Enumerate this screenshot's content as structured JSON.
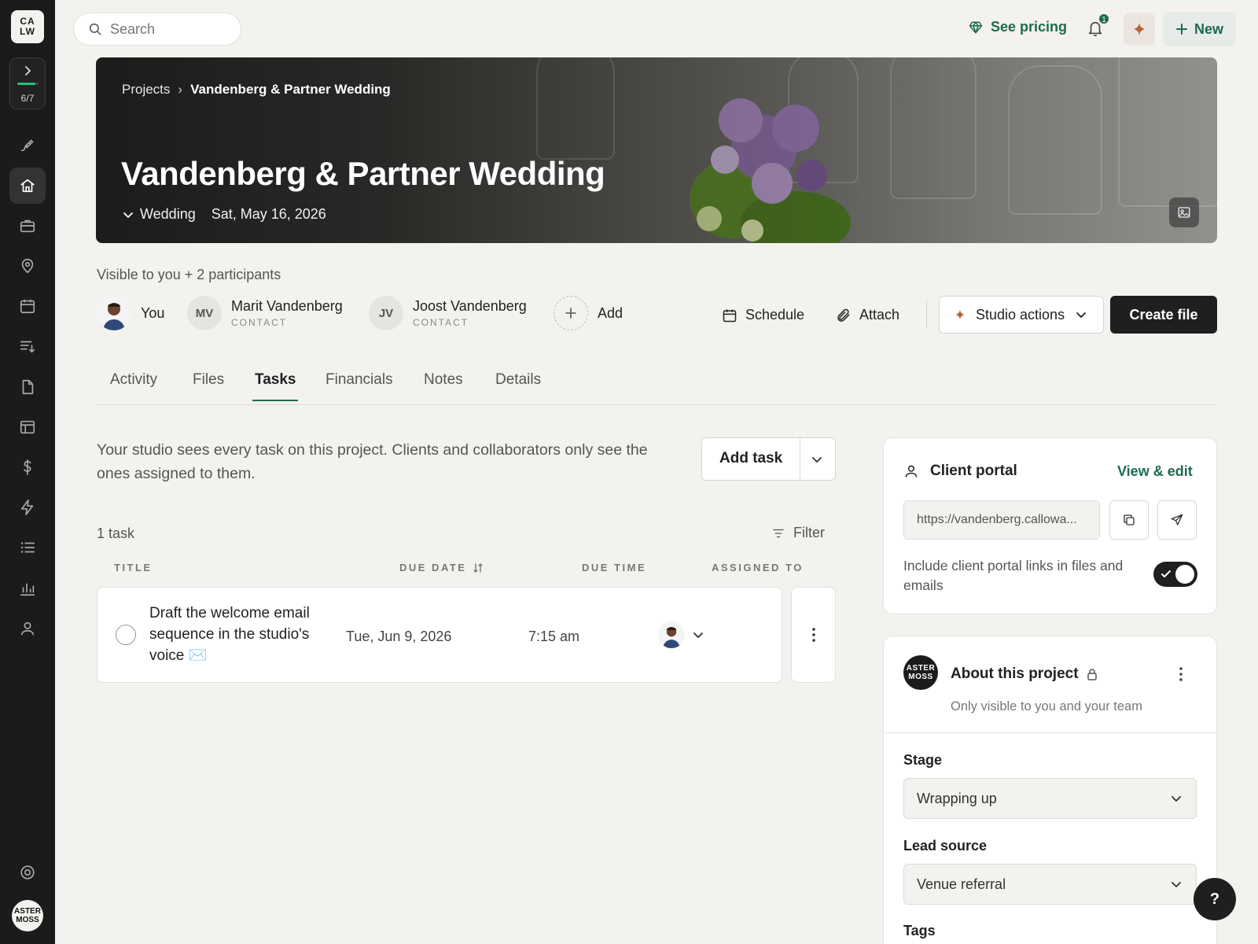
{
  "sidebar": {
    "logo": "CA\nLW",
    "progress": {
      "label": "6/7",
      "fraction": 0.857
    },
    "user_initials": "ASTER\nMOSS"
  },
  "topbar": {
    "search_placeholder": "Search",
    "see_pricing": "See pricing",
    "notification_count": "1",
    "new_label": "New"
  },
  "hero": {
    "breadcrumb_root": "Projects",
    "breadcrumb_sep": "›",
    "breadcrumb_current": "Vandenberg & Partner Wedding",
    "title": "Vandenberg & Partner Wedding",
    "type": "Wedding",
    "date": "Sat, May 16, 2026"
  },
  "participants": {
    "visibility": "Visible to you + 2 participants",
    "you": "You",
    "people": [
      {
        "initials": "MV",
        "name": "Marit Vandenberg",
        "role": "CONTACT"
      },
      {
        "initials": "JV",
        "name": "Joost Vandenberg",
        "role": "CONTACT"
      }
    ],
    "add": "Add"
  },
  "actions": {
    "schedule": "Schedule",
    "attach": "Attach",
    "studio_actions": "Studio actions",
    "create_file": "Create file"
  },
  "tabs": [
    "Activity",
    "Files",
    "Tasks",
    "Financials",
    "Notes",
    "Details"
  ],
  "active_tab": "Tasks",
  "tasks": {
    "description": "Your studio sees every task on this project. Clients and collaborators only see the ones assigned to them.",
    "add_task": "Add task",
    "count": "1 task",
    "filter": "Filter",
    "columns": {
      "title": "TITLE",
      "due_date": "DUE DATE",
      "due_time": "DUE TIME",
      "assigned_to": "ASSIGNED TO"
    },
    "rows": [
      {
        "title": "Draft the welcome email sequence in the studio's voice ✉️",
        "due_date": "Tue, Jun 9, 2026",
        "due_time": "7:15 am"
      }
    ]
  },
  "client_portal": {
    "title": "Client portal",
    "view_edit": "View & edit",
    "url": "https://vandenberg.callowa...",
    "include_text": "Include client portal links in files and emails",
    "include_enabled": true
  },
  "about": {
    "avatar": "ASTER\nMOSS",
    "title": "About this project",
    "subtitle": "Only visible to you and your team",
    "stage_label": "Stage",
    "stage_value": "Wrapping up",
    "lead_source_label": "Lead source",
    "lead_source_value": "Venue referral",
    "tags_label": "Tags"
  },
  "help": "?",
  "colors": {
    "accent": "#1d6b4f",
    "sidebar": "#1b1b1b",
    "progress": "#21c27a"
  }
}
